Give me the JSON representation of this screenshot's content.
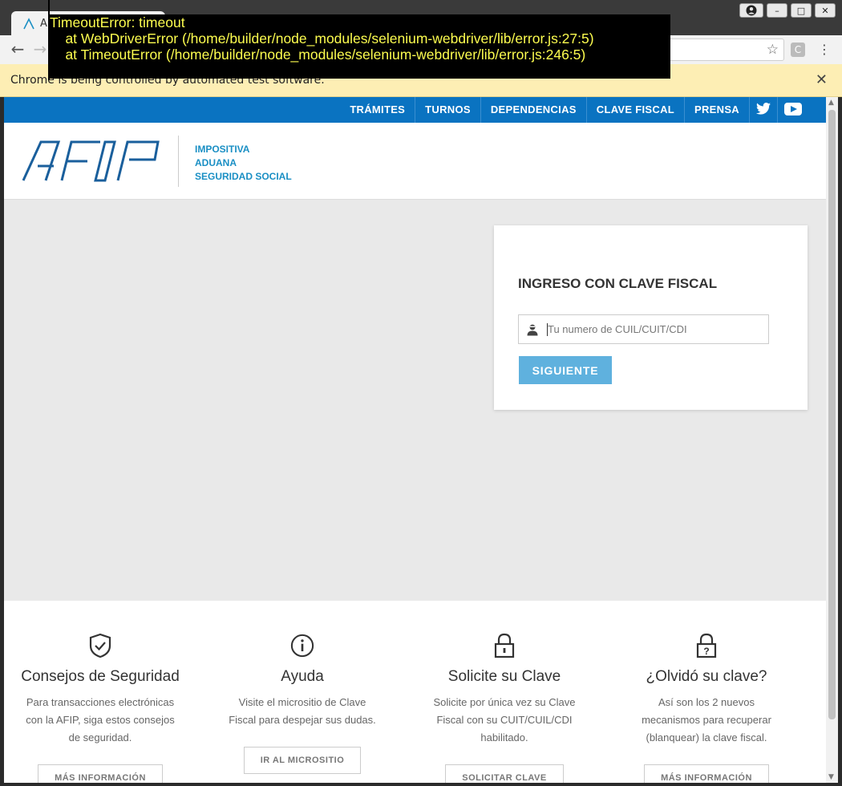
{
  "browser": {
    "tab_title": "A",
    "infobar_text": "Chrome is being controlled by automated test software.",
    "infobar_close": "✕",
    "back": "←",
    "forward": "→",
    "star": "☆",
    "extension_letter": "C",
    "menu": "⋮",
    "win_minimize": "–",
    "win_maximize": "□",
    "win_close": "✕"
  },
  "error_overlay": {
    "line1": "TimeoutError: timeout",
    "line2": "    at WebDriverError (/home/builder/node_modules/selenium-webdriver/lib/error.js:27:5)",
    "line3": "    at TimeoutError (/home/builder/node_modules/selenium-webdriver/lib/error.js:246:5)"
  },
  "topnav": {
    "items": [
      "TRÁMITES",
      "TURNOS",
      "DEPENDENCIAS",
      "CLAVE FISCAL",
      "PRENSA"
    ],
    "twitter_icon": "twitter-icon",
    "youtube_icon": "youtube-icon"
  },
  "header": {
    "logo_alt": "AFIP",
    "links": [
      "IMPOSITIVA",
      "ADUANA",
      "SEGURIDAD SOCIAL"
    ]
  },
  "login": {
    "title": "INGRESO CON CLAVE FISCAL",
    "input_placeholder": "Tu numero de CUIL/CUIT/CDI",
    "button_label": "SIGUIENTE"
  },
  "footer": {
    "features": [
      {
        "icon": "shield-check-icon",
        "title": "Consejos de Seguridad",
        "desc": [
          "Para transacciones electrónicas",
          "con la AFIP, siga estos consejos",
          "de seguridad."
        ],
        "button": "MÁS INFORMACIÓN"
      },
      {
        "icon": "info-icon",
        "title": "Ayuda",
        "desc": [
          "Visite el micrositio de Clave",
          "Fiscal para despejar sus dudas."
        ],
        "button": "IR AL MICROSITIO"
      },
      {
        "icon": "lock-icon",
        "title": "Solicite su Clave",
        "desc": [
          "Solicite por única vez su Clave",
          "Fiscal con su CUIT/CUIL/CDI",
          "habilitado."
        ],
        "button": "SOLICITAR CLAVE"
      },
      {
        "icon": "lock-question-icon",
        "title": "¿Olvidó su clave?",
        "desc": [
          "Así son los 2 nuevos",
          "mecanismos para recuperar",
          "(blanquear) la clave fiscal."
        ],
        "button": "MÁS INFORMACIÓN"
      }
    ]
  },
  "colors": {
    "nav_blue": "#0a73c1",
    "link_blue": "#1a8fc4",
    "button_blue": "#5fb1de",
    "infobar": "#fdeeb4",
    "error_text": "#fdfd4f"
  }
}
